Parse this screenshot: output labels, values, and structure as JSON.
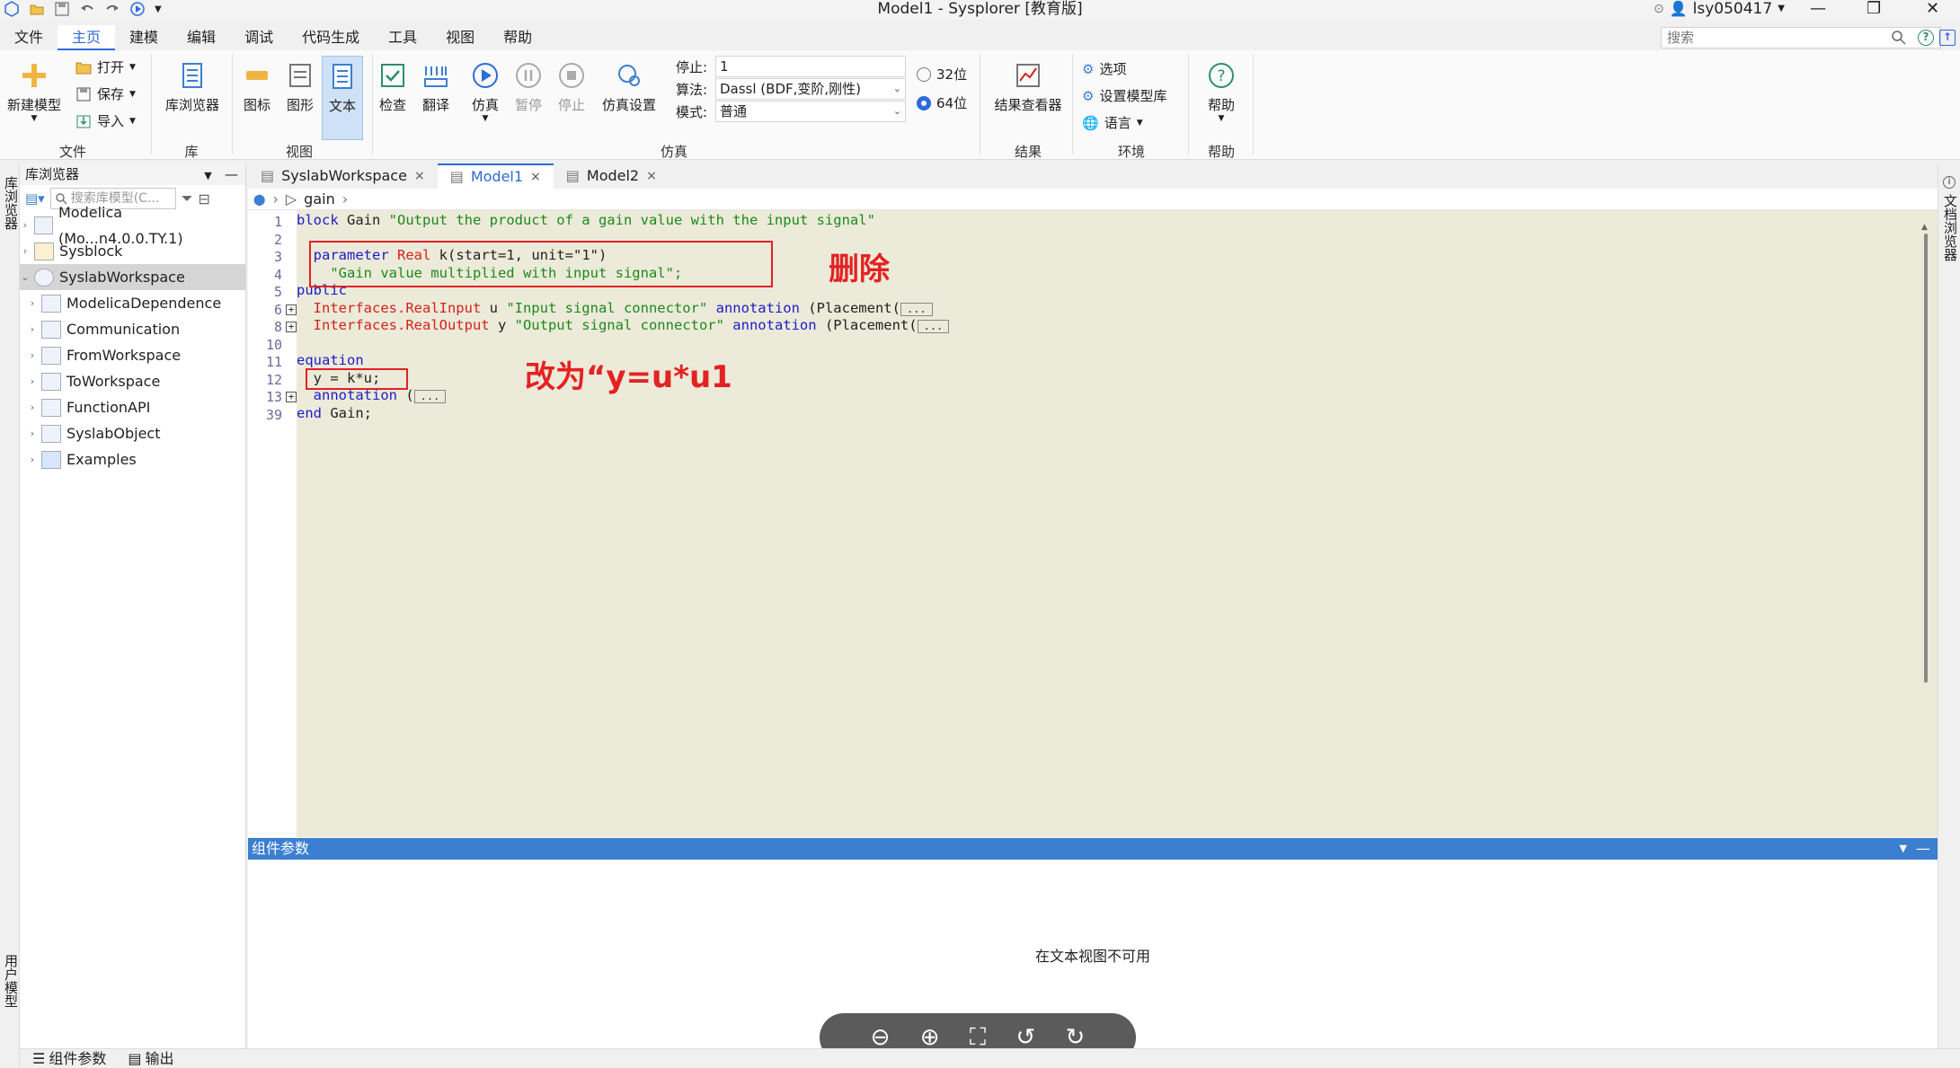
{
  "window": {
    "title": "Model1 - Sysplorer [教育版]",
    "user": "lsy050417",
    "search_placeholder": "搜索"
  },
  "menu": [
    "文件",
    "主页",
    "建模",
    "编辑",
    "调试",
    "代码生成",
    "工具",
    "视图",
    "帮助"
  ],
  "ribbon": {
    "file": {
      "new_model": "新建模型",
      "open": "打开",
      "save": "保存",
      "import": "导入",
      "group": "文件"
    },
    "lib": {
      "lib_browser": "库浏览器",
      "group": "库"
    },
    "view": {
      "icon": "图标",
      "diagram": "图形",
      "text": "文本",
      "group": "视图"
    },
    "sim": {
      "check": "检查",
      "translate": "翻译",
      "simulate": "仿真",
      "pause": "暂停",
      "stop": "停止",
      "sim_settings": "仿真设置",
      "stop_label": "停止:",
      "stop_value": "1",
      "algo_label": "算法:",
      "algo_value": "Dassl (BDF,变阶,刚性)",
      "mode_label": "模式:",
      "mode_value": "普通",
      "bit32": "32位",
      "bit64": "64位",
      "bit_selected": "64位",
      "group": "仿真"
    },
    "result": {
      "viewer": "结果查看器",
      "group": "结果"
    },
    "env": {
      "options": "选项",
      "set_lib": "设置模型库",
      "language": "语言",
      "group": "环境"
    },
    "help": {
      "help": "帮助",
      "group": "帮助"
    }
  },
  "left_strip": {
    "lib_tab": "库浏览器",
    "user_tab": "用户模型"
  },
  "lib_browser": {
    "title": "库浏览器",
    "search_placeholder": "搜索库模型(C...",
    "items": [
      {
        "label": "Modelica (Mo...n4.0.0.TY.1)",
        "level": 0
      },
      {
        "label": "Sysblock",
        "level": 0
      },
      {
        "label": "SyslabWorkspace",
        "level": 0,
        "selected": true,
        "expanded": true
      },
      {
        "label": "ModelicaDependence",
        "level": 1
      },
      {
        "label": "Communication",
        "level": 1
      },
      {
        "label": "FromWorkspace",
        "level": 1
      },
      {
        "label": "ToWorkspace",
        "level": 1
      },
      {
        "label": "FunctionAPI",
        "level": 1
      },
      {
        "label": "SyslabObject",
        "level": 1
      },
      {
        "label": "Examples",
        "level": 1
      }
    ]
  },
  "tabs": [
    {
      "label": "SyslabWorkspace",
      "active": false
    },
    {
      "label": "Model1",
      "active": true
    },
    {
      "label": "Model2",
      "active": false
    }
  ],
  "breadcrumb": {
    "item": "gain"
  },
  "code": {
    "line_numbers": [
      "1",
      "2",
      "3",
      "4",
      "5",
      "6",
      "8",
      "10",
      "11",
      "12",
      "13",
      "39"
    ],
    "l1_kw": "block",
    "l1_name": " Gain ",
    "l1_str": "\"Output the product of a gain value with the input signal\"",
    "l3_kw": "parameter",
    "l3_typ": "Real",
    "l3_rest": " k(start=1, unit=\"1\")",
    "l4_str": "\"Gain value multiplied with input signal\";",
    "l5_kw": "public",
    "l6_typ": "Interfaces.RealInput",
    "l6_u": " u ",
    "l6_str": "\"Input signal connector\"",
    "l6_ann": "annotation",
    "l6_place": " (Placement(",
    "l8_typ": "Interfaces.RealOutput",
    "l8_y": " y ",
    "l8_str": "\"Output signal connector\"",
    "l8_ann": "annotation",
    "l8_place": " (Placement(",
    "l11_kw": "equation",
    "l12_code": "y = k*u;",
    "l13_ann": "annotation",
    "l13_paren": " (",
    "l39_kw": "end",
    "l39_rest": " Gain;",
    "ellipsis": "..."
  },
  "annotations": {
    "delete": "删除",
    "change_to": "改为“y=u*u1"
  },
  "component_params": {
    "title": "组件参数",
    "notice": "在文本视图不可用"
  },
  "bottom_tabs": [
    "组件参数",
    "输出"
  ],
  "right_strip": {
    "doc_tab": "文档浏览器"
  },
  "colors": {
    "accent": "#2d6bd8",
    "editor_bg": "#ecead9",
    "annotation_red": "#e32222",
    "panel_bar": "#3c7fd0"
  }
}
